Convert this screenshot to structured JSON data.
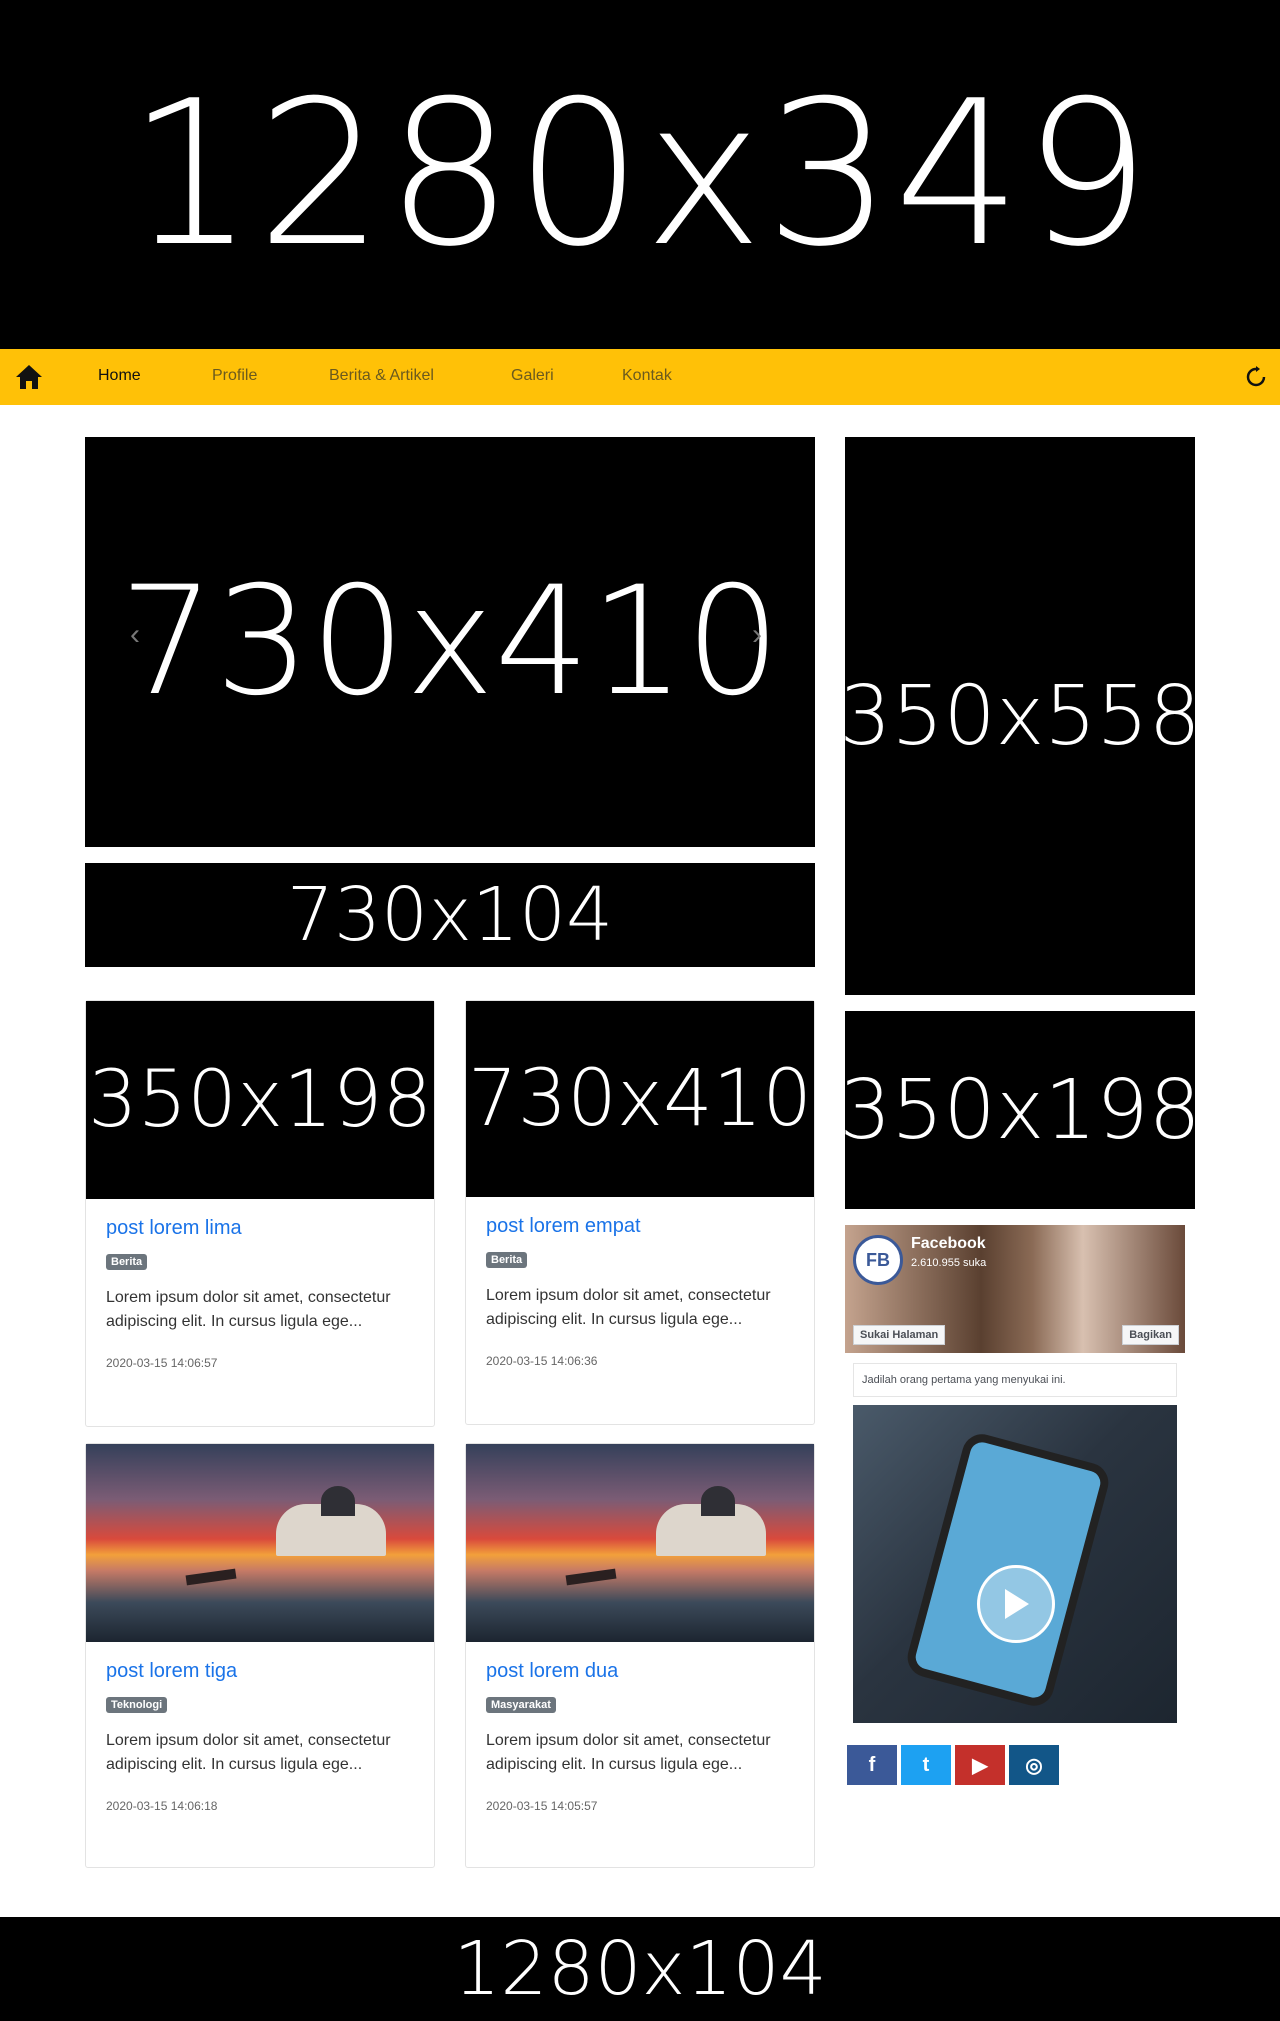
{
  "top_banner": {
    "text": "1280x349"
  },
  "nav": {
    "items": [
      {
        "label": "Home",
        "active": true
      },
      {
        "label": "Profile",
        "active": false
      },
      {
        "label": "Berita & Artikel",
        "active": false
      },
      {
        "label": "Galeri",
        "active": false
      },
      {
        "label": "Kontak",
        "active": false
      }
    ],
    "home_icon": "home-icon",
    "refresh_icon": "refresh-icon",
    "bg_color": "#ffc107"
  },
  "slider": {
    "text": "730x410",
    "prev": "‹",
    "next": "›"
  },
  "ad_mid": {
    "text": "730x104"
  },
  "ad_side": {
    "text": "350x558"
  },
  "ad_side2": {
    "text": "350x198"
  },
  "posts": [
    {
      "thumb": "350x198",
      "title": "post lorem lima",
      "category": "Berita",
      "excerpt": "Lorem ipsum dolor sit amet, consectetur adipiscing elit. In cursus ligula ege...",
      "date": "2020-03-15 14:06:57"
    },
    {
      "thumb": "730x410",
      "title": "post lorem empat",
      "category": "Berita",
      "excerpt": "Lorem ipsum dolor sit amet, consectetur adipiscing elit. In cursus ligula ege...",
      "date": "2020-03-15 14:06:36"
    },
    {
      "thumb": "",
      "title": "post lorem tiga",
      "category": "Teknologi",
      "excerpt": "Lorem ipsum dolor sit amet, consectetur adipiscing elit. In cursus ligula ege...",
      "date": "2020-03-15 14:06:18"
    },
    {
      "thumb": "",
      "title": "post lorem dua",
      "category": "Masyarakat",
      "excerpt": "Lorem ipsum dolor sit amet, consectetur adipiscing elit. In cursus ligula ege...",
      "date": "2020-03-15 14:05:57"
    }
  ],
  "facebook": {
    "logo": "FB",
    "page_name": "Facebook",
    "likes": "2.610.955 suka",
    "like_button": "Sukai Halaman",
    "share_button": "Bagikan",
    "first_text": "Jadilah orang pertama yang menyukai ini."
  },
  "social": [
    {
      "icon": "facebook-icon",
      "glyph": "f",
      "color": "#3b5998"
    },
    {
      "icon": "twitter-icon",
      "glyph": "t",
      "color": "#1da1f2"
    },
    {
      "icon": "youtube-icon",
      "glyph": "▶",
      "color": "#c4302b"
    },
    {
      "icon": "instagram-icon",
      "glyph": "◎",
      "color": "#125688"
    }
  ],
  "footer": {
    "text": "1280x104"
  }
}
